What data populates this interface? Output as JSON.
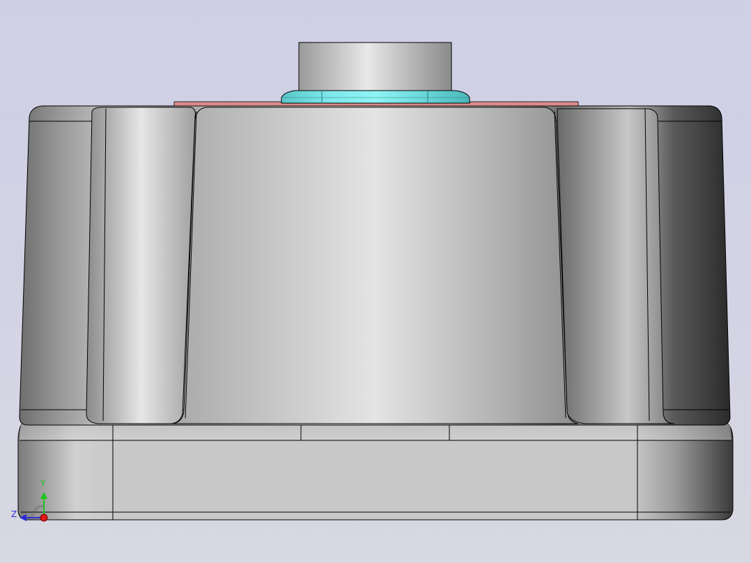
{
  "viewport": {
    "background_top": "#cfcfe6",
    "background_bottom": "#d8d8e2",
    "edge_color": "#000000"
  },
  "model": {
    "body_shading": "grey-metal",
    "nut_color": "#7de8ea",
    "washer_color": "#d98b8b",
    "boss_color": "#c8c8c8"
  },
  "triad": {
    "y_label": "Y",
    "z_label": "Z",
    "y_color": "#19c719",
    "z_color": "#2a2ad8",
    "x_color": "#e01818"
  }
}
